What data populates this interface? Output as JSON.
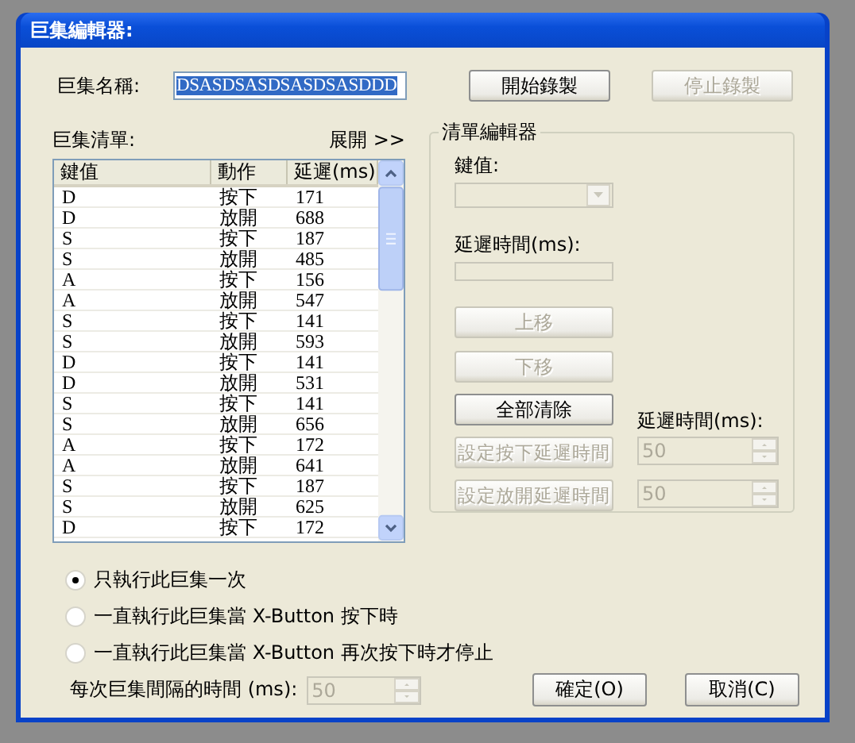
{
  "window": {
    "title": "巨集編輯器:"
  },
  "macro_name": {
    "label": "巨集名稱:",
    "value": "DSASDSASDSASDSASDDD",
    "selected": true
  },
  "record_buttons": [
    {
      "label": "開始錄製",
      "disabled": false
    },
    {
      "label": "停止錄製",
      "disabled": true
    }
  ],
  "macro_list": {
    "label": "巨集清單:",
    "expand_link": "展開 >>",
    "columns": [
      "鍵值",
      "動作",
      "延遲(ms)"
    ],
    "rows": [
      [
        "D",
        "按下",
        "171"
      ],
      [
        "D",
        "放開",
        "688"
      ],
      [
        "S",
        "按下",
        "187"
      ],
      [
        "S",
        "放開",
        "485"
      ],
      [
        "A",
        "按下",
        "156"
      ],
      [
        "A",
        "放開",
        "547"
      ],
      [
        "S",
        "按下",
        "141"
      ],
      [
        "S",
        "放開",
        "593"
      ],
      [
        "D",
        "按下",
        "141"
      ],
      [
        "D",
        "放開",
        "531"
      ],
      [
        "S",
        "按下",
        "141"
      ],
      [
        "S",
        "放開",
        "656"
      ],
      [
        "A",
        "按下",
        "172"
      ],
      [
        "A",
        "放開",
        "641"
      ],
      [
        "S",
        "按下",
        "187"
      ],
      [
        "S",
        "放開",
        "625"
      ],
      [
        "D",
        "按下",
        "172"
      ]
    ]
  },
  "list_editor": {
    "title": "清單編輯器",
    "key": {
      "label": "鍵值:",
      "disabled": true
    },
    "delay": {
      "label": "延遲時間(ms):",
      "disabled": true
    },
    "buttons": [
      {
        "label": "上移",
        "disabled": true
      },
      {
        "label": "下移",
        "disabled": true
      },
      {
        "label": "全部清除",
        "disabled": false
      }
    ],
    "delay_label": "延遲時間(ms):",
    "set_rows": [
      {
        "label": "設定按下延遲時間",
        "disabled": true,
        "value": "50"
      },
      {
        "label": "設定放開延遲時間",
        "disabled": true,
        "value": "50"
      }
    ]
  },
  "run_modes": [
    {
      "label": "只執行此巨集一次",
      "selected": true
    },
    {
      "label": "一直執行此巨集當 X-Button 按下時",
      "selected": false
    },
    {
      "label": "一直執行此巨集當 X-Button 再次按下時才停止",
      "selected": false
    }
  ],
  "interval": {
    "label": "每次巨集間隔的時間 (ms):",
    "value": "50",
    "disabled": true
  },
  "dialog_buttons": [
    {
      "label": "確定(O)",
      "disabled": false
    },
    {
      "label": "取消(C)",
      "disabled": false
    }
  ]
}
